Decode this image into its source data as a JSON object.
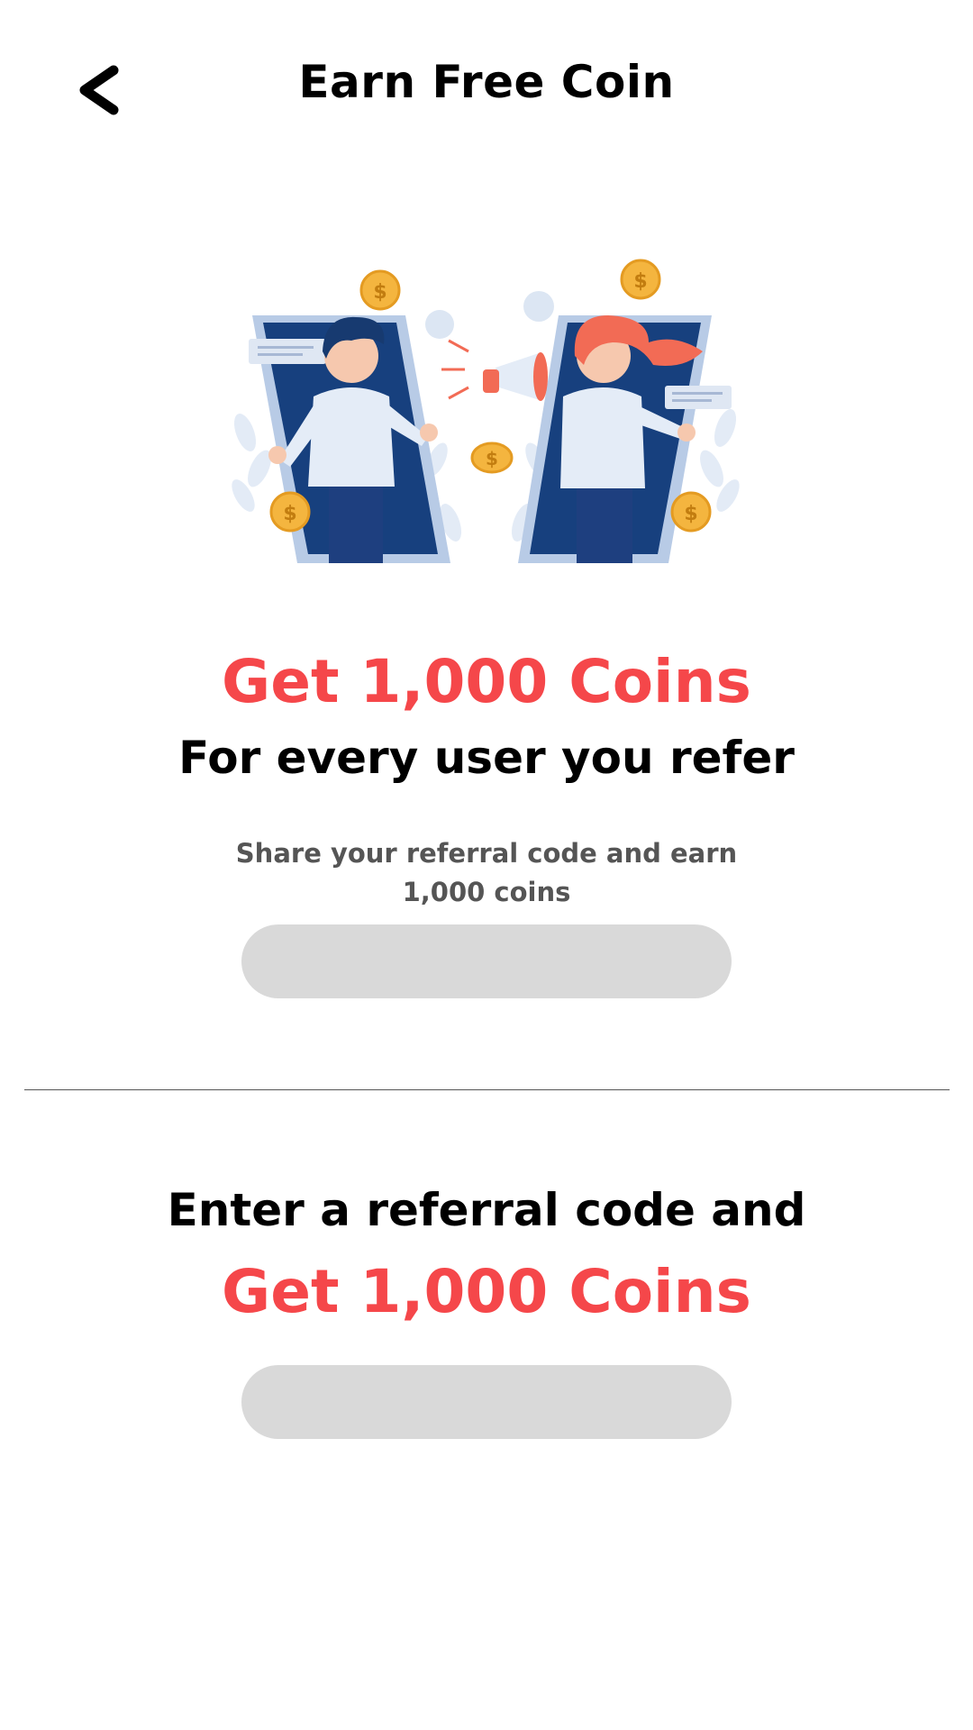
{
  "header": {
    "title": "Earn Free Coin",
    "back_icon": "chevron-left-icon"
  },
  "illustration": {
    "name": "referral-illustration"
  },
  "refer_section": {
    "headline": "Get 1,000 Coins",
    "subheadline": "For every user you refer",
    "hint": "Share your referral code and earn 1,000 coins",
    "code_value": ""
  },
  "enter_section": {
    "headline": "Enter a referral code and",
    "reward": "Get 1,000 Coins",
    "input_value": "",
    "input_placeholder": ""
  },
  "colors": {
    "accent": "#f5474a",
    "pill": "#d9d9d9",
    "hint_text": "#555555",
    "illustration_navy": "#1a3f7a",
    "coin": "#f4b53f"
  }
}
